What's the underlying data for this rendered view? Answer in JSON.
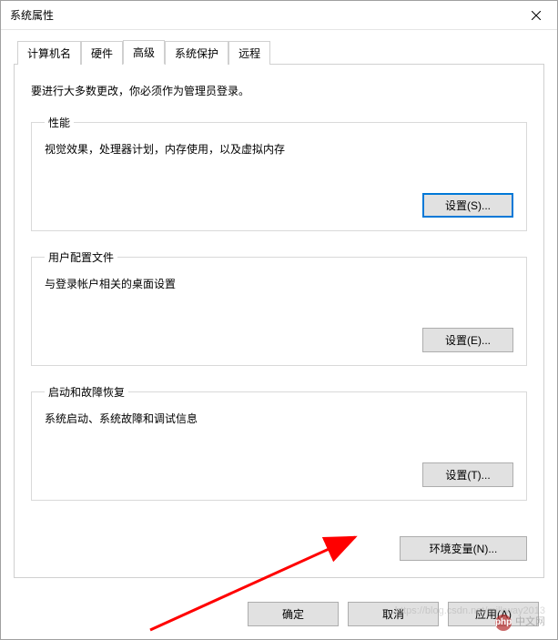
{
  "window": {
    "title": "系统属性"
  },
  "tabs": {
    "computer_name": "计算机名",
    "hardware": "硬件",
    "advanced": "高级",
    "system_protection": "系统保护",
    "remote": "远程"
  },
  "admin_note": "要进行大多数更改，你必须作为管理员登录。",
  "groups": {
    "performance": {
      "legend": "性能",
      "desc": "视觉效果，处理器计划，内存使用，以及虚拟内存",
      "button": "设置(S)..."
    },
    "user_profiles": {
      "legend": "用户配置文件",
      "desc": "与登录帐户相关的桌面设置",
      "button": "设置(E)..."
    },
    "startup_recovery": {
      "legend": "启动和故障恢复",
      "desc": "系统启动、系统故障和调试信息",
      "button": "设置(T)..."
    }
  },
  "env_button": "环境变量(N)...",
  "footer": {
    "ok": "确定",
    "cancel": "取消",
    "apply": "应用(A)"
  },
  "watermark": {
    "brand": "中文网",
    "url": "https://blog.csdn.net/milkway2013"
  }
}
